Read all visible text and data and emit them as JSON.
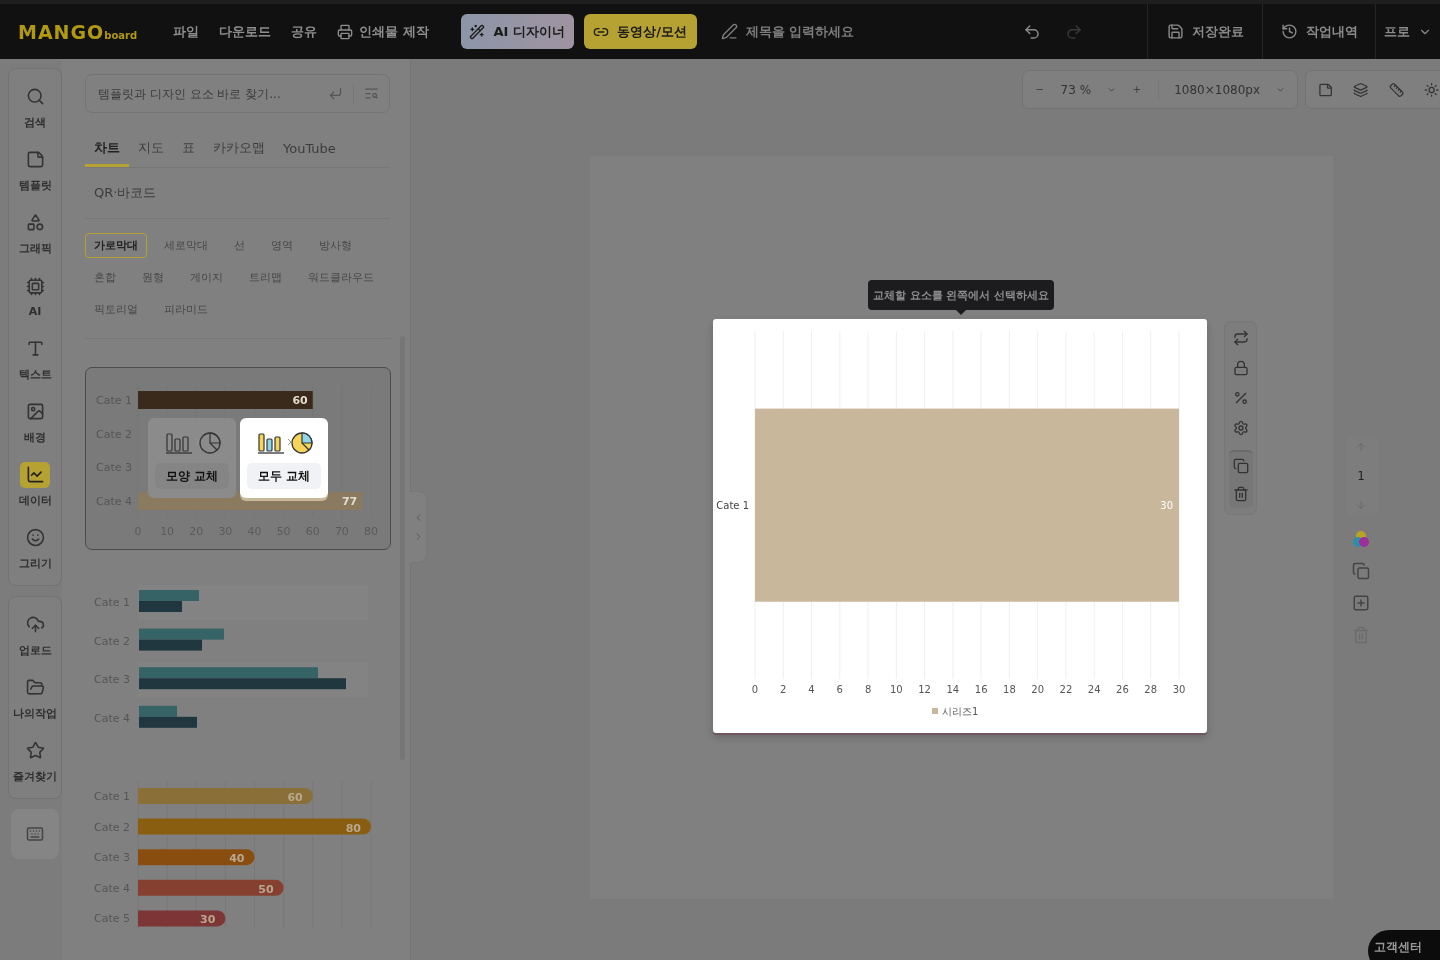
{
  "topbar": {
    "logo": {
      "main": "MANGO",
      "sub": "board"
    },
    "menu": [
      {
        "label": "파일",
        "kind": "text"
      },
      {
        "label": "다운로드",
        "kind": "text"
      },
      {
        "label": "공유",
        "kind": "text"
      },
      {
        "label": "인쇄물 제작",
        "kind": "print"
      }
    ],
    "ai_button": "AI 디자이너",
    "motion_button": "동영상/모션",
    "title_placeholder": "제목을 입력하세요",
    "redo_disabled": true,
    "save_status": "저장완료",
    "history": "작업내역",
    "plan": "프로"
  },
  "rail": [
    {
      "items": [
        {
          "label": "검색",
          "selected": false
        },
        {
          "label": "템플릿",
          "selected": false
        },
        {
          "label": "그래픽",
          "selected": false
        },
        {
          "label": "AI",
          "selected": false
        },
        {
          "label": "텍스트",
          "selected": false
        },
        {
          "label": "배경",
          "selected": false
        },
        {
          "label": "데이터",
          "selected": true
        },
        {
          "label": "그리기",
          "selected": false
        }
      ]
    },
    {
      "items": [
        {
          "label": "업로드",
          "selected": false
        },
        {
          "label": "나의작업",
          "selected": false
        },
        {
          "label": "즐겨찾기",
          "selected": false
        }
      ]
    }
  ],
  "panel": {
    "search": {
      "placeholder": "템플릿과 디자인 요소 바로 찾기..."
    },
    "tabs": [
      {
        "label": "차트",
        "selected": true
      },
      {
        "label": "지도",
        "selected": false
      },
      {
        "label": "표",
        "selected": false
      },
      {
        "label": "카카오맵",
        "selected": false
      },
      {
        "label": "YouTube",
        "selected": false
      }
    ],
    "tabs_row2": [
      {
        "label": "QR·바코드",
        "selected": false
      }
    ],
    "chart_types": [
      {
        "label": "가로막대",
        "selected": true
      },
      {
        "label": "세로막대",
        "selected": false
      },
      {
        "label": "선",
        "selected": false
      },
      {
        "label": "영역",
        "selected": false
      },
      {
        "label": "방사형",
        "selected": false
      },
      {
        "label": "혼합",
        "selected": false
      },
      {
        "label": "원형",
        "selected": false
      },
      {
        "label": "게이지",
        "selected": false
      },
      {
        "label": "트리맵",
        "selected": false
      },
      {
        "label": "워드클라우드",
        "selected": false
      },
      {
        "label": "픽토리얼",
        "selected": false
      },
      {
        "label": "피라미드",
        "selected": false
      }
    ],
    "thumbnails": [
      {
        "kind": "labeled",
        "selected": true,
        "chart_data": {
          "type": "bar",
          "orientation": "horizontal",
          "categories": [
            "Cate 1",
            "Cate 2",
            "Cate 3",
            "Cate 4"
          ],
          "series": [
            {
              "values": [
                60,
                null,
                null,
                77
              ]
            }
          ],
          "xlim": [
            0,
            80
          ],
          "xticks": [
            0,
            10,
            20,
            30,
            40,
            50,
            60,
            70,
            80
          ],
          "grid": true,
          "data_labels": true
        },
        "replace_options": [
          {
            "label": "모양 교체",
            "selected": false
          },
          {
            "label": "모두 교체",
            "selected": true
          }
        ]
      },
      {
        "kind": "grouped",
        "selected": false,
        "labels": [
          "Cate 1",
          "Cate 2",
          "Cate 3",
          "Cate 4"
        ]
      },
      {
        "kind": "rounded",
        "selected": false,
        "chart_data": {
          "type": "bar",
          "orientation": "horizontal",
          "categories": [
            "Cate 1",
            "Cate 2",
            "Cate 3",
            "Cate 4",
            "Cate 5"
          ],
          "series": [
            {
              "values": [
                60,
                80,
                40,
                50,
                30
              ]
            }
          ],
          "xlim": [
            0,
            80
          ],
          "grid": true,
          "data_labels": true
        }
      }
    ]
  },
  "canvas": {
    "zoom": "73 %",
    "size": "1080×1080px",
    "tooltip": "교체할 요소를 왼쪽에서 선택하세요",
    "chart_data": {
      "type": "bar",
      "orientation": "horizontal",
      "categories": [
        "Cate 1"
      ],
      "series": [
        {
          "name": "시리즈1",
          "color": "#c9b79c",
          "values": [
            30
          ]
        }
      ],
      "xlim": [
        0,
        30
      ],
      "xticks": [
        0,
        2,
        4,
        6,
        8,
        10,
        12,
        14,
        16,
        18,
        20,
        22,
        24,
        26,
        28,
        30
      ],
      "grid": true,
      "data_labels": true
    },
    "page_number": "1"
  },
  "help_button": "고객센터"
}
